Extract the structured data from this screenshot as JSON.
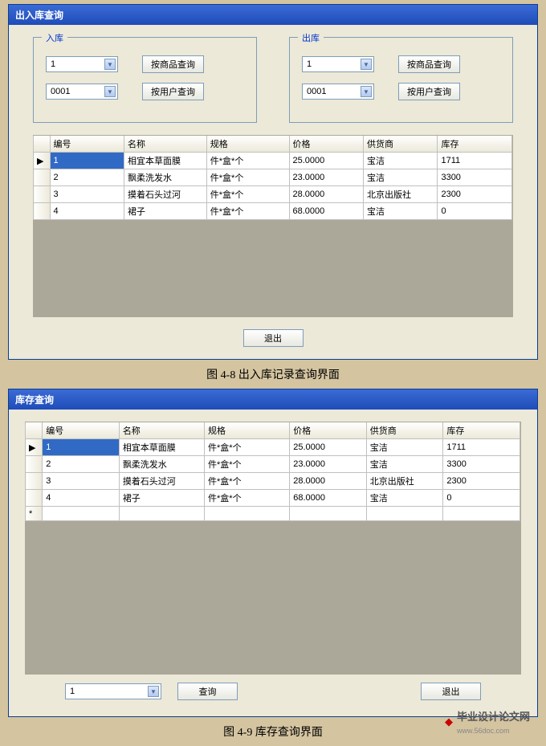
{
  "window1": {
    "title": "出入库查询",
    "panel_in": {
      "label": "入库",
      "combo1": "1",
      "combo2": "0001"
    },
    "panel_out": {
      "label": "出库",
      "combo1": "1",
      "combo2": "0001"
    },
    "btn_product": "按商品查询",
    "btn_user": "按用户查询",
    "btn_exit": "退出",
    "headers": {
      "id": "编号",
      "name": "名称",
      "spec": "规格",
      "price": "价格",
      "supplier": "供货商",
      "stock": "库存"
    },
    "rows": [
      {
        "id": "1",
        "name": "相宜本草面膜",
        "spec": "件*盒*个",
        "price": "25.0000",
        "supplier": "宝洁",
        "stock": "1711"
      },
      {
        "id": "2",
        "name": "飘柔洗发水",
        "spec": "件*盒*个",
        "price": "23.0000",
        "supplier": "宝洁",
        "stock": "3300"
      },
      {
        "id": "3",
        "name": "摸着石头过河",
        "spec": "件*盒*个",
        "price": "28.0000",
        "supplier": "北京出版社",
        "stock": "2300"
      },
      {
        "id": "4",
        "name": "裙子",
        "spec": "件*盒*个",
        "price": "68.0000",
        "supplier": "宝洁",
        "stock": "0"
      }
    ]
  },
  "caption1": "图 4-8 出入库记录查询界面",
  "window2": {
    "title": "库存查询",
    "headers": {
      "id": "编号",
      "name": "名称",
      "spec": "规格",
      "price": "价格",
      "supplier": "供货商",
      "stock": "库存"
    },
    "rows": [
      {
        "id": "1",
        "name": "相宜本草面膜",
        "spec": "件*盒*个",
        "price": "25.0000",
        "supplier": "宝洁",
        "stock": "1711"
      },
      {
        "id": "2",
        "name": "飘柔洗发水",
        "spec": "件*盒*个",
        "price": "23.0000",
        "supplier": "宝洁",
        "stock": "3300"
      },
      {
        "id": "3",
        "name": "摸着石头过河",
        "spec": "件*盒*个",
        "price": "28.0000",
        "supplier": "北京出版社",
        "stock": "2300"
      },
      {
        "id": "4",
        "name": "裙子",
        "spec": "件*盒*个",
        "price": "68.0000",
        "supplier": "宝洁",
        "stock": "0"
      }
    ],
    "combo": "1",
    "btn_query": "查询",
    "btn_exit": "退出"
  },
  "caption2": "图 4-9 库存查询界面",
  "logo_text": "毕业设计论文网",
  "logo_url": "www.56doc.com"
}
